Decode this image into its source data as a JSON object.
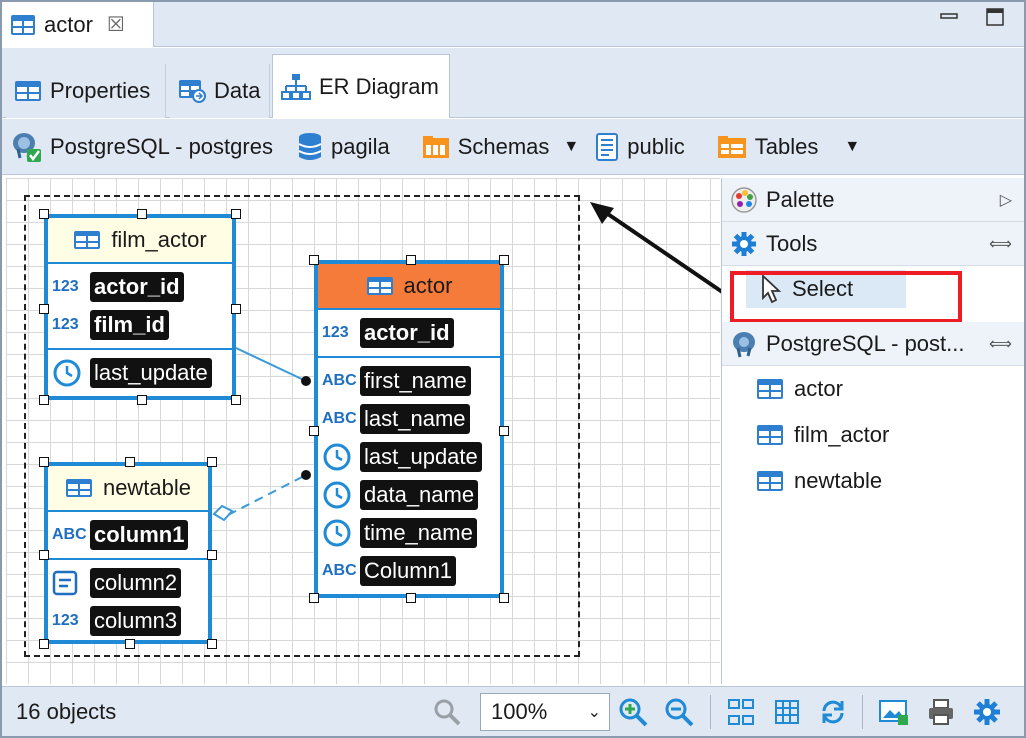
{
  "window": {
    "doc_tab": "actor",
    "close_glyph": "☒"
  },
  "editor_tabs": [
    {
      "label": "Properties",
      "icon": "table-icon"
    },
    {
      "label": "Data",
      "icon": "data-icon"
    },
    {
      "label": "ER Diagram",
      "icon": "er-diagram-icon",
      "active": true
    }
  ],
  "toolbar": {
    "connection": "PostgreSQL - postgres",
    "database": "pagila",
    "schemas": "Schemas",
    "schema": "public",
    "tables": "Tables"
  },
  "diagram": {
    "entities": {
      "film_actor": {
        "title": "film_actor",
        "key_cols": [
          {
            "type": "123",
            "name": "actor_id"
          },
          {
            "type": "123",
            "name": "film_id"
          }
        ],
        "cols": [
          {
            "type": "clock",
            "name": "last_update"
          }
        ]
      },
      "actor": {
        "title": "actor",
        "key_cols": [
          {
            "type": "123",
            "name": "actor_id"
          }
        ],
        "cols": [
          {
            "type": "ABC",
            "name": "first_name"
          },
          {
            "type": "ABC",
            "name": "last_name"
          },
          {
            "type": "clock",
            "name": "last_update"
          },
          {
            "type": "clock",
            "name": "data_name"
          },
          {
            "type": "clock",
            "name": "time_name"
          },
          {
            "type": "ABC",
            "name": "Column1"
          }
        ]
      },
      "newtable": {
        "title": "newtable",
        "key_cols": [
          {
            "type": "ABC",
            "name": "column1"
          }
        ],
        "cols": [
          {
            "type": "doc",
            "name": "column2"
          },
          {
            "type": "123",
            "name": "column3"
          }
        ]
      }
    },
    "colors": {
      "entity_border": "#1f8ad6",
      "actor_header": "#f47b3a",
      "entity_header": "#fffde4",
      "highlight": "#ee1c25"
    }
  },
  "panel": {
    "palette": "Palette",
    "tools": "Tools",
    "select": "Select",
    "db_section": "PostgreSQL - post...",
    "tables": [
      "actor",
      "film_actor",
      "newtable"
    ]
  },
  "status": {
    "objects": "16 objects",
    "zoom": "100%"
  }
}
